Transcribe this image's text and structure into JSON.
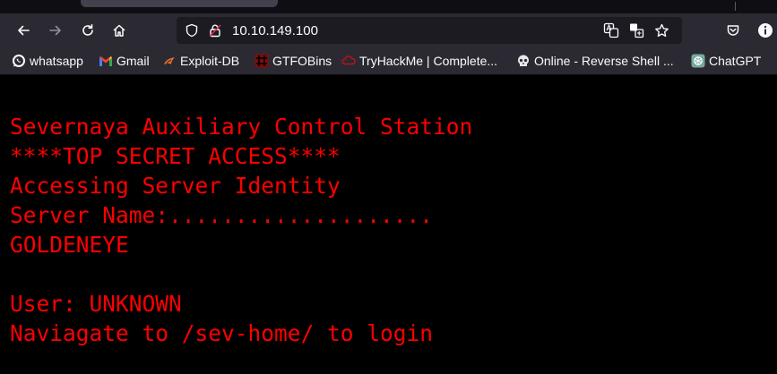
{
  "browser": {
    "url": "10.10.149.100",
    "bookmarks": [
      {
        "label": "whatsapp",
        "icon": "whatsapp-icon"
      },
      {
        "label": "Gmail",
        "icon": "gmail-icon"
      },
      {
        "label": "Exploit-DB",
        "icon": "exploit-db-icon"
      },
      {
        "label": "GTFOBins",
        "icon": "gtfobins-icon"
      },
      {
        "label": "TryHackMe | Complete...",
        "icon": "tryhackme-icon"
      },
      {
        "label": "Online - Reverse Shell ...",
        "icon": "skull-icon"
      },
      {
        "label": "ChatGPT",
        "icon": "chatgpt-icon"
      }
    ]
  },
  "page": {
    "lines": [
      "Severnaya Auxiliary Control Station",
      "****TOP SECRET ACCESS****",
      "Accessing Server Identity",
      "Server Name:....................",
      "GOLDENEYE",
      "User: UNKNOWN",
      "Naviagate to /sev-home/ to login"
    ],
    "color": "#ff0000",
    "background": "#000000"
  }
}
